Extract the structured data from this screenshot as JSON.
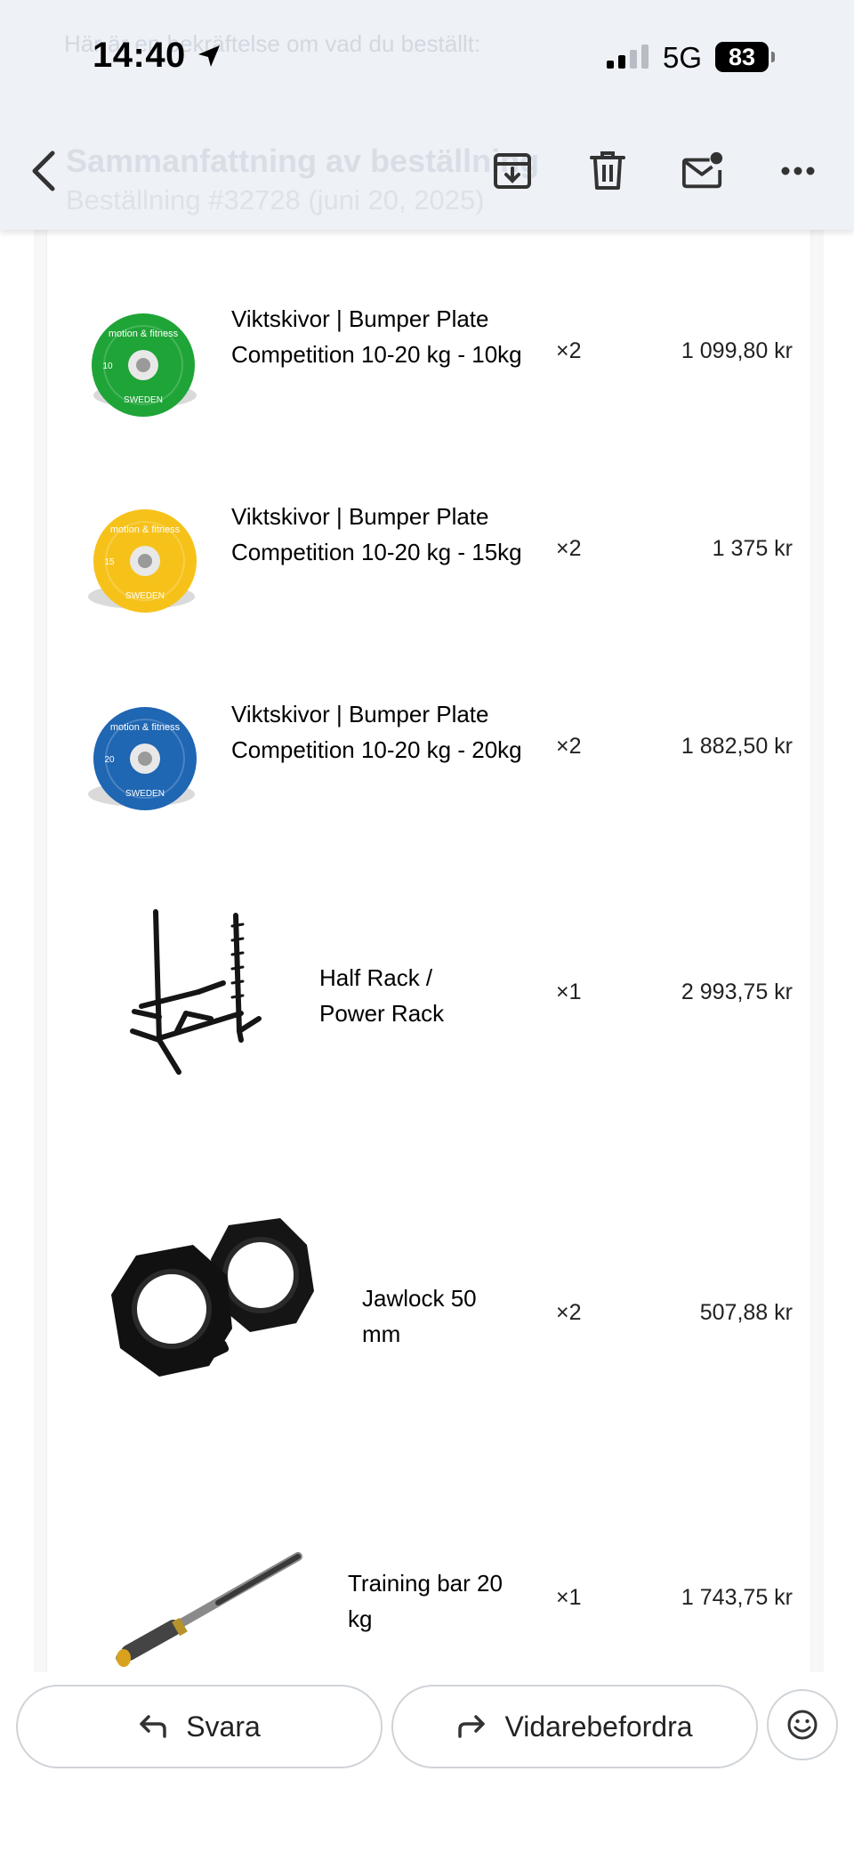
{
  "status_bar": {
    "time": "14:40",
    "network": "5G",
    "battery": "83"
  },
  "header": {
    "preheader": "Här är en bekräftelse om vad du beställt:",
    "title": "Sammanfattning av beställning",
    "subtitle": "Beställning #32728 (juni 20, 2025)"
  },
  "order_items": [
    {
      "name": "Viktskivor | Bumper Plate Competition 10-20 kg - 10kg",
      "quantity": "×2",
      "price": "1 099,80 kr",
      "plate_color": "#1fa437",
      "plate_label": "10"
    },
    {
      "name": "Viktskivor | Bumper Plate Competition 10-20 kg - 15kg",
      "quantity": "×2",
      "price": "1 375 kr",
      "plate_color": "#f6c21a",
      "plate_label": "15"
    },
    {
      "name": "Viktskivor | Bumper Plate Competition 10-20 kg - 20kg",
      "quantity": "×2",
      "price": "1 882,50 kr",
      "plate_color": "#1f66b3",
      "plate_label": "20"
    },
    {
      "name": "Half Rack / Power Rack",
      "quantity": "×1",
      "price": "2 993,75 kr"
    },
    {
      "name": "Jawlock 50 mm",
      "quantity": "×2",
      "price": "507,88 kr"
    },
    {
      "name": "Training bar 20 kg",
      "quantity": "×1",
      "price": "1 743,75 kr"
    }
  ],
  "plate_brand": "motion & fitness",
  "plate_origin": "SWEDEN",
  "actions": {
    "reply": "Svara",
    "forward": "Vidarebefordra"
  },
  "icons": [
    "location-arrow-icon",
    "signal-icon",
    "back-icon",
    "archive-icon",
    "trash-icon",
    "mark-unread-icon",
    "more-icon",
    "reply-icon",
    "forward-icon",
    "emoji-icon"
  ]
}
